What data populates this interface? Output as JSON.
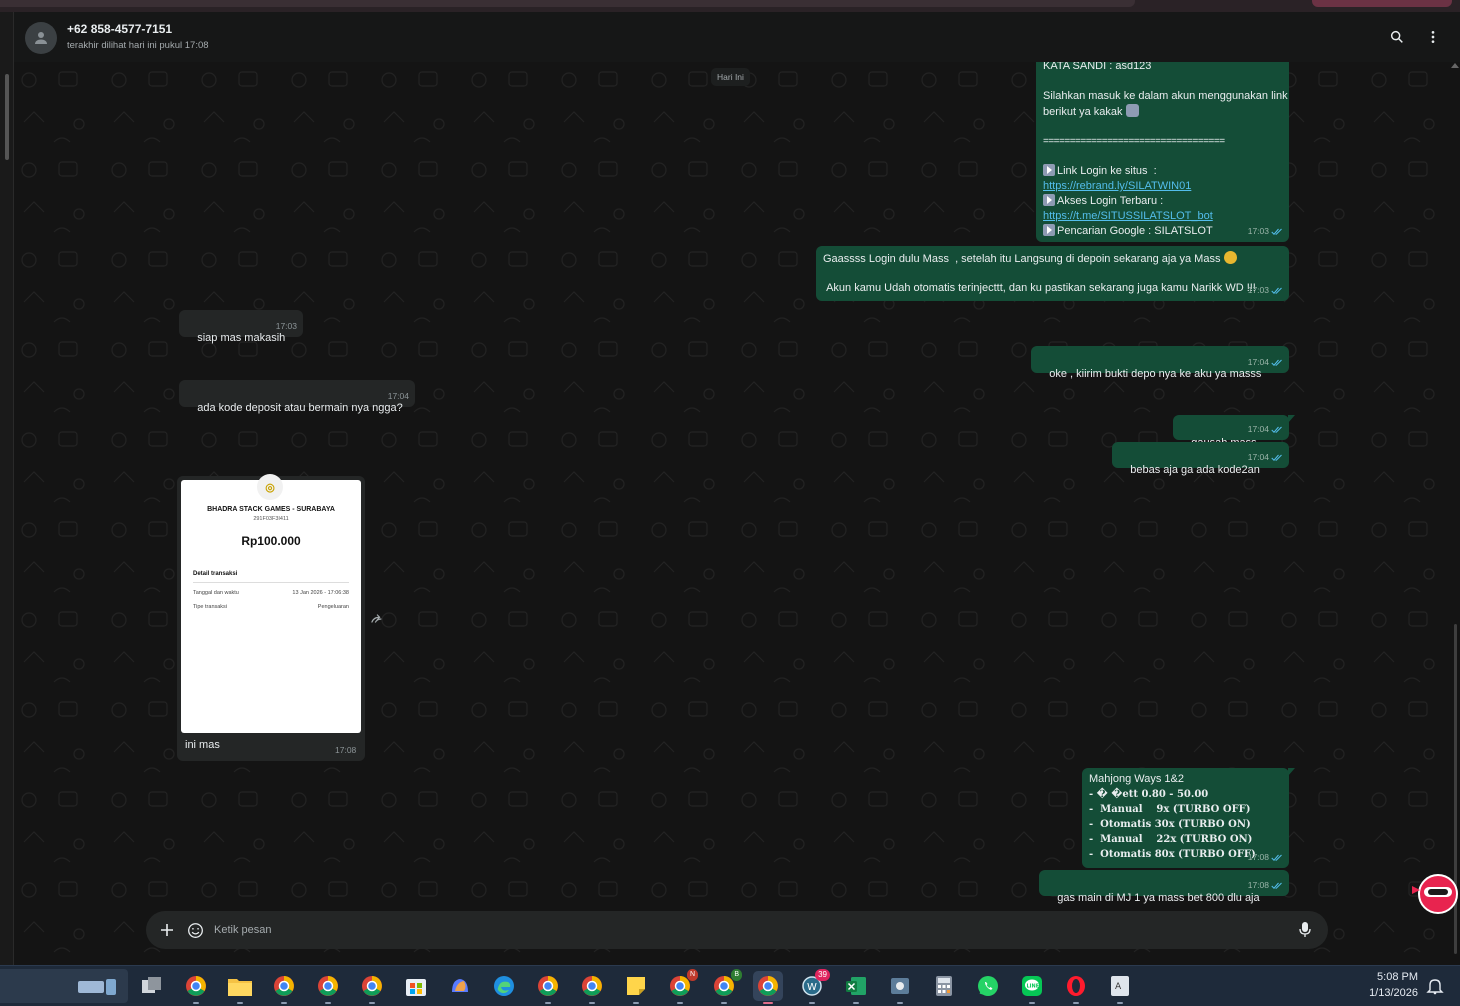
{
  "header": {
    "contact_name": "+62 858-4577-7151",
    "contact_status": "terakhir dilihat hari ini pukul 17:08",
    "icons": [
      "search-icon",
      "kebab-menu-icon"
    ]
  },
  "date_chip": "Hari Ini",
  "messages": {
    "m1": {
      "lines": [
        "KATA SANDI : asd123",
        "",
        "Silahkan masuk ke dalam akun menggunakan link",
        "berikut ya kakak",
        "",
        "==================================",
        "",
        "Link Login ke situs  :",
        "https://rebrand.ly/SILATWIN01",
        "Akses Login Terbaru :",
        "https://t.me/SITUSSILATSLOT_bot",
        "Pencarian Google : SILATSLOT"
      ],
      "time": "17:03"
    },
    "m2": {
      "line1": "Gaassss Login dulu Mass  , setelah itu Langsung di depoin sekarang aja ya Mass",
      "line2": " Akun kamu Udah otomatis terinjecttt, dan ku pastikan sekarang juga kamu Narikk WD !!!",
      "time": "17:03"
    },
    "m3": {
      "text": "siap mas makasih",
      "time": "17:03"
    },
    "m4": {
      "text": "oke , kiirim bukti depo nya ke aku ya masss",
      "time": "17:04"
    },
    "m5": {
      "text": "ada kode deposit atau bermain nya ngga?",
      "time": "17:04"
    },
    "m6": {
      "text": "gausah mass",
      "time": "17:04"
    },
    "m7": {
      "text": "bebas aja ga ada kode2an",
      "time": "17:04"
    },
    "m8": {
      "caption": "ini mas",
      "time": "17:08",
      "receipt": {
        "merchant": "BHADRA STACK GAMES - SURABAYA",
        "code": "291F03F3I411",
        "amount": "Rp100.000",
        "detail_title": "Detail transaksi",
        "row1_label": "Tanggal dan waktu",
        "row1_value": "13 Jan 2026 - 17:06:38",
        "row2_label": "Tipe transaksi",
        "row2_value": "Pengeluaran"
      }
    },
    "m9": {
      "title": "Mahjong Ways 1&2",
      "lines": [
        "� �ett 0.80 - 50.00",
        "Manual    9x (TURBO OFF)",
        "Otomatis 30x (TURBO ON)",
        "Manual    22x (TURBO ON)",
        "Otomatis 80x (TURBO OFF)"
      ],
      "time": "17:08"
    },
    "m10": {
      "text": "gas main di MJ 1 ya mass bet 800 dlu aja",
      "time": "17:08"
    }
  },
  "composer": {
    "placeholder": "Ketik pesan"
  },
  "taskbar": {
    "badge_count": "39",
    "chrome_badge_b": "B",
    "chrome_badge_n": "N",
    "time": "5:08 PM",
    "date": "1/13/2026"
  },
  "colors": {
    "outgoing_bubble": "#144d37",
    "incoming_bubble": "#242626",
    "link": "#53bdeb",
    "background": "#141414"
  }
}
